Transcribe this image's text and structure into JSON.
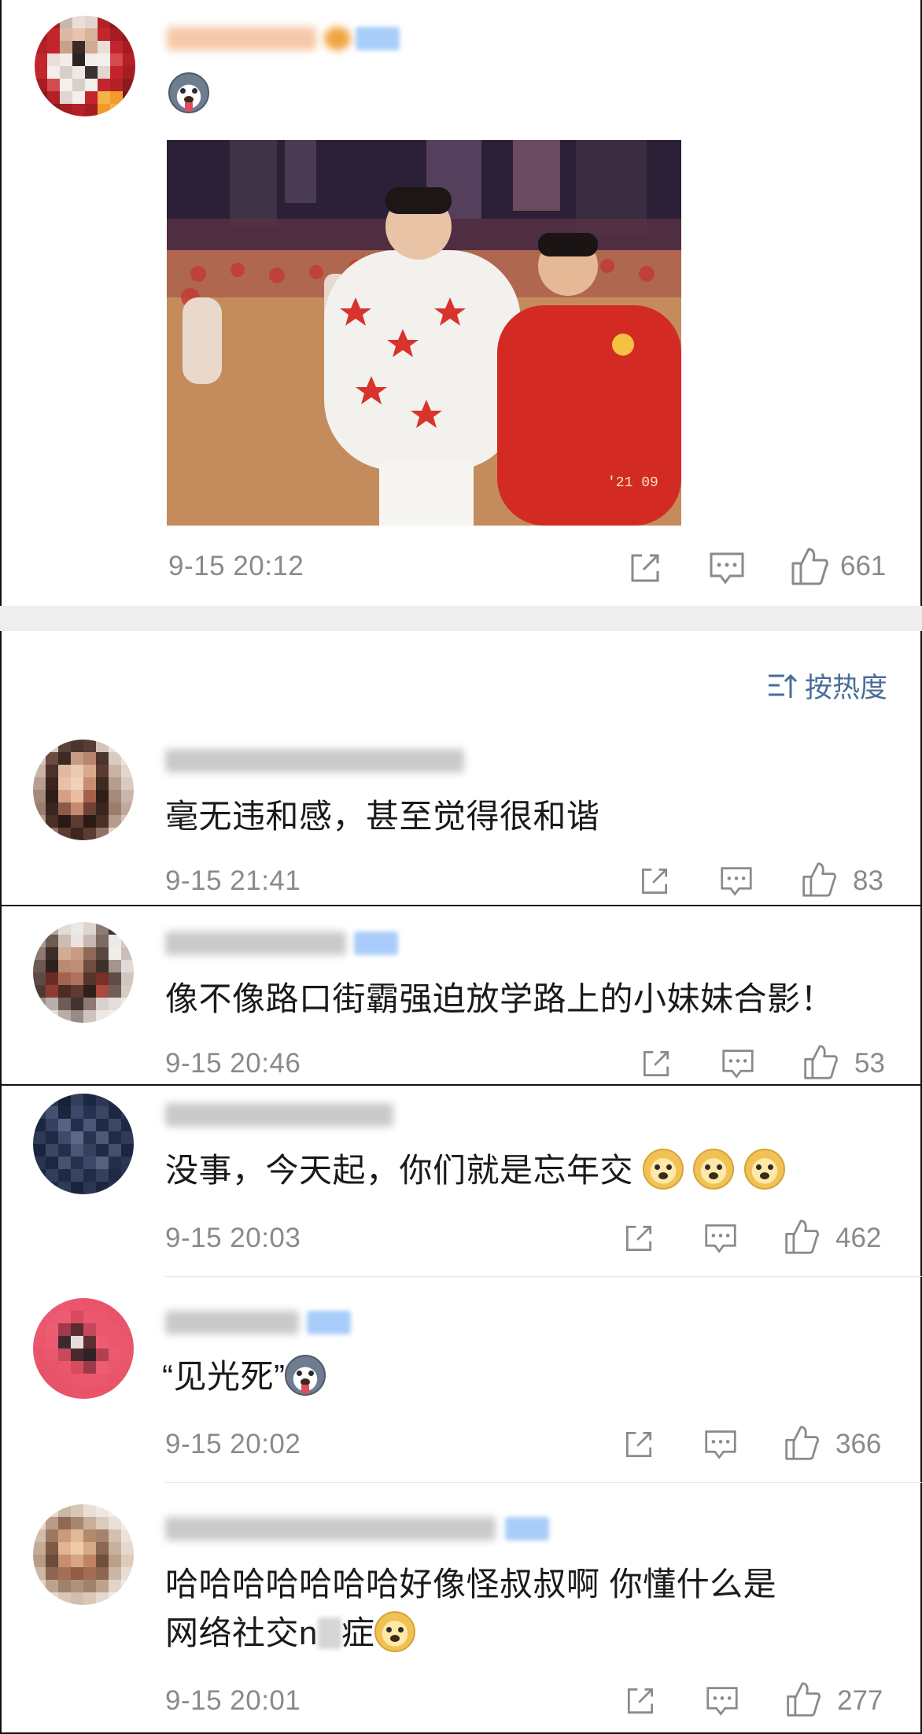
{
  "post": {
    "time": "9-15 20:12",
    "like_count": "661"
  },
  "sort": {
    "label": "按热度"
  },
  "comments": [
    {
      "text": "毫无违和感，甚至觉得很和谐",
      "time": "9-15 21:41",
      "likes": "83"
    },
    {
      "text": "像不像路口街霸强迫放学路上的小妹妹合影！",
      "time": "9-15 20:46",
      "likes": "53"
    },
    {
      "text": "没事，今天起，你们就是忘年交",
      "time": "9-15 20:03",
      "likes": "462"
    },
    {
      "text": "“见光死”",
      "time": "9-15 20:02",
      "likes": "366"
    },
    {
      "text_line1": "哈哈哈哈哈哈哈好像怪叔叔啊 你懂什么是",
      "text_line2_a": "网络社交n",
      "text_line2_b": "症",
      "time": "9-15 20:01",
      "likes": "277"
    }
  ],
  "photo_stamp": "'21 09",
  "icons": {
    "repost": "repost-icon",
    "comment": "comment-icon",
    "like": "thumbs-up-icon",
    "sort": "sort-icon",
    "doge": "doge-emoji",
    "husky": "husky-emoji"
  }
}
